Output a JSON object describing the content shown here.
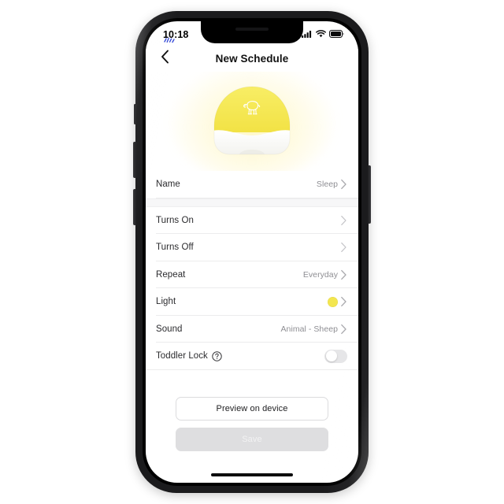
{
  "status_bar": {
    "time": "10:18",
    "cellular_icon": "cellular-signal-icon",
    "wifi_icon": "wifi-icon",
    "battery_icon": "battery-icon",
    "notch_indicator_icon": "activity-indicator-icon"
  },
  "navbar": {
    "back_icon": "chevron-left-icon",
    "title": "New Schedule"
  },
  "hero": {
    "device_icon": "night-light-dome-icon",
    "animal_icon": "sheep-icon",
    "dome_color": "#f4e74f",
    "base_color": "#fbfbf8",
    "glow_color": "#fff0a0"
  },
  "list": {
    "rows": [
      {
        "label": "Name",
        "value": "Sleep",
        "accessory": "chevron"
      },
      {
        "label": "Turns On",
        "value": "",
        "accessory": "chevron"
      },
      {
        "label": "Turns Off",
        "value": "",
        "accessory": "chevron"
      },
      {
        "label": "Repeat",
        "value": "Everyday",
        "accessory": "chevron"
      },
      {
        "label": "Light",
        "value": "",
        "accessory": "swatch-chevron",
        "swatch_color": "#f3e64f"
      },
      {
        "label": "Sound",
        "value": "Animal - Sheep",
        "accessory": "chevron"
      },
      {
        "label": "Toddler Lock",
        "value": "",
        "accessory": "toggle",
        "toggle_on": false,
        "help_icon": "question-mark-circle-icon"
      }
    ]
  },
  "actions": {
    "preview_label": "Preview on device",
    "save_label": "Save"
  },
  "colors": {
    "accent_yellow": "#f3e64f",
    "label_text": "#2b2b2e",
    "value_text": "#8e8e93",
    "separator": "#ececed",
    "disabled_button_bg": "#dedee0"
  }
}
